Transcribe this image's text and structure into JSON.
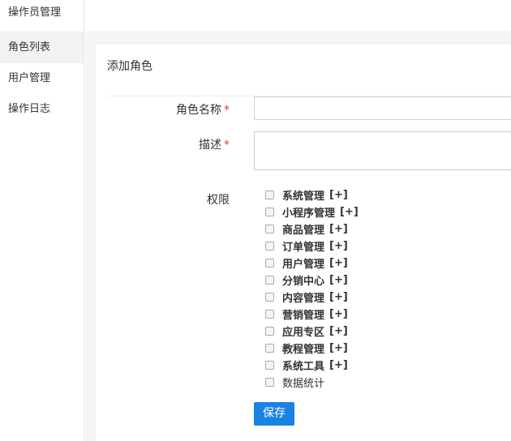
{
  "sidebar": {
    "title": "操作员管理",
    "items": [
      {
        "label": "角色列表",
        "active": true
      },
      {
        "label": "用户管理",
        "active": false
      },
      {
        "label": "操作日志",
        "active": false
      }
    ]
  },
  "panel": {
    "header": "添加角色"
  },
  "form": {
    "role_name_label": "角色名称",
    "role_name_value": "",
    "description_label": "描述",
    "description_value": "",
    "required_mark": "*",
    "permissions_label": "权限",
    "permissions": [
      {
        "label": "系统管理",
        "expand": "[+]",
        "checked": false
      },
      {
        "label": "小程序管理",
        "expand": "[+]",
        "checked": false
      },
      {
        "label": "商品管理",
        "expand": "[+]",
        "checked": false
      },
      {
        "label": "订单管理",
        "expand": "[+]",
        "checked": false
      },
      {
        "label": "用户管理",
        "expand": "[+]",
        "checked": false
      },
      {
        "label": "分销中心",
        "expand": "[+]",
        "checked": false
      },
      {
        "label": "内容管理",
        "expand": "[+]",
        "checked": false
      },
      {
        "label": "营销管理",
        "expand": "[+]",
        "checked": false
      },
      {
        "label": "应用专区",
        "expand": "[+]",
        "checked": false
      },
      {
        "label": "教程管理",
        "expand": "[+]",
        "checked": false
      },
      {
        "label": "系统工具",
        "expand": "[+]",
        "checked": false
      },
      {
        "label": "数据统计",
        "expand": "",
        "checked": false
      }
    ],
    "save_label": "保存"
  },
  "colors": {
    "accent": "#1a82e2",
    "required": "#e33333"
  }
}
